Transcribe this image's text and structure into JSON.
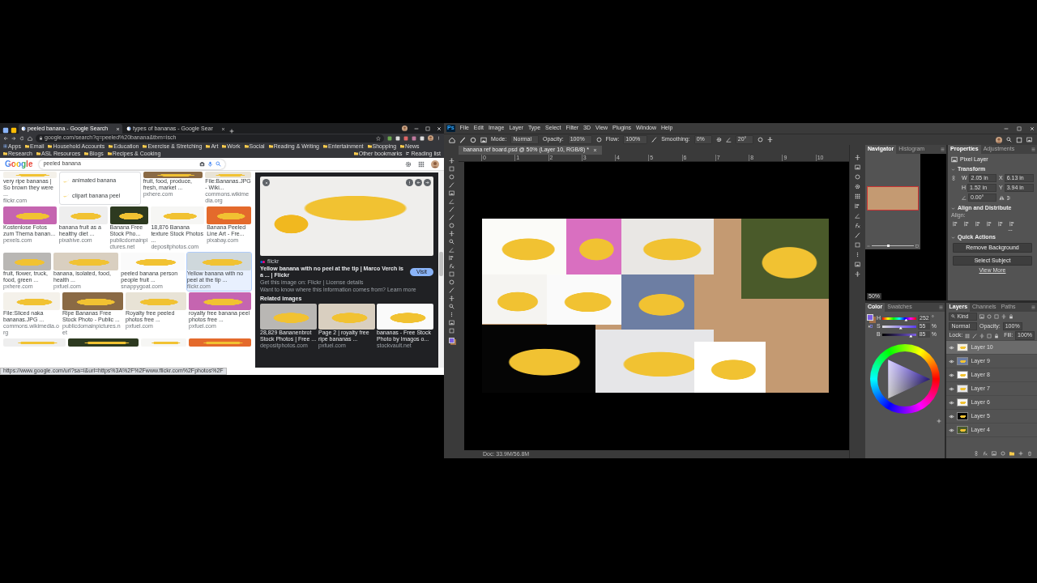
{
  "browser": {
    "tabs": [
      {
        "label": "peeled banana - Google Search",
        "selected": true
      },
      {
        "label": "types of bananas - Google Sear",
        "selected": false
      }
    ],
    "address": "google.com/search?q=peeled%20banana&tbm=isch",
    "bookmarks": [
      "Apps",
      "Email",
      "Household Accounts",
      "Education",
      "Exercise & Stretching",
      "Art",
      "Work",
      "Social",
      "Reading & Writing",
      "Entertainment",
      "Shopping",
      "News",
      "Research",
      "ASL Resources",
      "Blogs",
      "Recipes & Cooking"
    ],
    "other_bookmarks": "Other bookmarks",
    "reading_list": "Reading list",
    "logo": "Google",
    "query": "peeled banana",
    "results": [
      [
        {
          "kind": "image",
          "caption": "very ripe bananas | So brown they were ...",
          "source": "flickr.com",
          "selected": false
        },
        {
          "kind": "suggestions",
          "items": [
            "animated banana",
            "clipart banana peel"
          ]
        },
        {
          "kind": "image",
          "caption": "fruit, food, produce, fresh, market ...",
          "source": "pxhere.com",
          "selected": false
        },
        {
          "kind": "image",
          "caption": "File:Bananas.JPG - Wiki...",
          "source": "commons.wikimedia.org",
          "selected": false
        }
      ],
      [
        {
          "kind": "image",
          "caption": "Kostenlose Fotos zum Thema banan...",
          "source": "pexels.com",
          "selected": false
        },
        {
          "kind": "image",
          "caption": "banana fruit as a healthy diet ...",
          "source": "pixahive.com",
          "selected": false
        },
        {
          "kind": "image",
          "caption": "Banana Free Stock Pho...",
          "source": "publicdomainpictures.net",
          "selected": false
        },
        {
          "kind": "image",
          "caption": "18,876 Banana texture Stock Photos ...",
          "source": "depositphotos.com",
          "selected": false
        },
        {
          "kind": "image",
          "caption": "Banana Peeled Line Art - Fre...",
          "source": "pixabay.com",
          "selected": false
        }
      ],
      [
        {
          "kind": "image",
          "caption": "fruit, flower, truck, food, green ...",
          "source": "pxhere.com",
          "selected": false
        },
        {
          "kind": "image",
          "caption": "banana, isolated, food, health ...",
          "source": "pxfuel.com",
          "selected": false
        },
        {
          "kind": "image",
          "caption": "peeled banana person people fruit ...",
          "source": "snappygoat.com",
          "selected": false
        },
        {
          "kind": "image",
          "caption": "Yellow banana with no peel at the tip ...",
          "source": "flickr.com",
          "selected": true
        }
      ],
      [
        {
          "kind": "image",
          "caption": "File:Sliced naka bananas.JPG ...",
          "source": "commons.wikimedia.org",
          "selected": false
        },
        {
          "kind": "image",
          "caption": "Ripe Bananas Free Stock Photo - Public ...",
          "source": "publicdomainpictures.net",
          "selected": false
        },
        {
          "kind": "image",
          "caption": "Royalty free peeled photos free ...",
          "source": "pxfuel.com",
          "selected": false
        },
        {
          "kind": "image",
          "caption": "royalty free banana peel photos free ...",
          "source": "pxfuel.com",
          "selected": false
        }
      ]
    ],
    "detail": {
      "source": "flickr",
      "title": "Yellow banana with no peel at the tip | Marco Verch is a ... | Flickr",
      "visit": "Visit",
      "get_info": "Get this image on: Flickr | License details",
      "info_text": "Want to know where this information comes from?",
      "info_link": "Learn more",
      "related_heading": "Related images",
      "related": [
        {
          "caption": "28,829 Bananenbrot Stock Photos | Free ...",
          "source": "depositphotos.com"
        },
        {
          "caption": "Page 2 | royalty free ripe bananas ...",
          "source": "pxfuel.com"
        },
        {
          "caption": "bananas - Free Stock Photo by Imagos o...",
          "source": "stockvault.net"
        }
      ]
    },
    "status_url": "https://www.google.com/url?sa=i&url=https%3A%2F%2Fwww.flickr.com%2Fphotos%2F"
  },
  "photoshop": {
    "logo": "Ps",
    "menu": [
      "File",
      "Edit",
      "Image",
      "Layer",
      "Type",
      "Select",
      "Filter",
      "3D",
      "View",
      "Plugins",
      "Window",
      "Help"
    ],
    "options": [
      {
        "label": "Mode:",
        "value": "Normal"
      },
      {
        "label": "Opacity:",
        "value": "100%"
      },
      {
        "label": "Flow:",
        "value": "100%"
      },
      {
        "label": "Smoothing:",
        "value": "0%"
      }
    ],
    "angle": "20°",
    "document_tab": "banana ref board.psd @ 50% (Layer 10, RGB/8) *",
    "ruler": [
      "0",
      "1",
      "2",
      "3",
      "4",
      "5",
      "6",
      "7",
      "8",
      "9",
      "10"
    ],
    "doc_status": "Doc: 33.9M/56.8M",
    "navigator": {
      "tabs": [
        {
          "label": "Navigator",
          "selected": true
        },
        {
          "label": "Histogram",
          "selected": false
        }
      ],
      "zoom_slider": {
        "level": 0.4
      },
      "zoom": "50%"
    },
    "properties": {
      "tabs": [
        {
          "label": "Properties",
          "selected": true
        },
        {
          "label": "Adjustments",
          "selected": false
        }
      ],
      "layer_type": "Pixel Layer",
      "transform_heading": "Transform",
      "fields": [
        {
          "label": "W",
          "value": "2.05 in"
        },
        {
          "label": "X",
          "value": "6.13 in"
        },
        {
          "label": "H",
          "value": "1.52 in"
        },
        {
          "label": "Y",
          "value": "3.94 in"
        }
      ],
      "rotation": "0.00°",
      "align_heading": "Align and Distribute",
      "align_label": "Align:",
      "quick_heading": "Quick Actions",
      "actions": [
        "Remove Background",
        "Select Subject"
      ],
      "view_more": "View More"
    },
    "color": {
      "tabs": [
        {
          "label": "Color",
          "selected": true
        },
        {
          "label": "Swatches",
          "selected": false
        }
      ],
      "sliders": [
        {
          "label": "H",
          "value": "252",
          "unit": "°",
          "level": 0.7
        },
        {
          "label": "S",
          "value": "55",
          "unit": "%",
          "level": 0.55
        },
        {
          "label": "B",
          "value": "85",
          "unit": "%",
          "level": 0.85
        }
      ]
    },
    "layers": {
      "tabs": [
        {
          "label": "Layers",
          "selected": true
        },
        {
          "label": "Channels",
          "selected": false
        },
        {
          "label": "Paths",
          "selected": false
        }
      ],
      "filter": "Kind",
      "blend": "Normal",
      "opacity_label": "Opacity:",
      "opacity": "100%",
      "lock_label": "Lock:",
      "fill_label": "Fill:",
      "fill": "100%",
      "items": [
        {
          "name": "Layer 10",
          "selected": true,
          "visible": true
        },
        {
          "name": "Layer 9",
          "selected": false,
          "visible": true
        },
        {
          "name": "Layer 8",
          "selected": false,
          "visible": true
        },
        {
          "name": "Layer 7",
          "selected": false,
          "visible": true
        },
        {
          "name": "Layer 6",
          "selected": false,
          "visible": true
        },
        {
          "name": "Layer 5",
          "selected": false,
          "visible": true
        },
        {
          "name": "Layer 4",
          "selected": false,
          "visible": true
        }
      ]
    }
  }
}
